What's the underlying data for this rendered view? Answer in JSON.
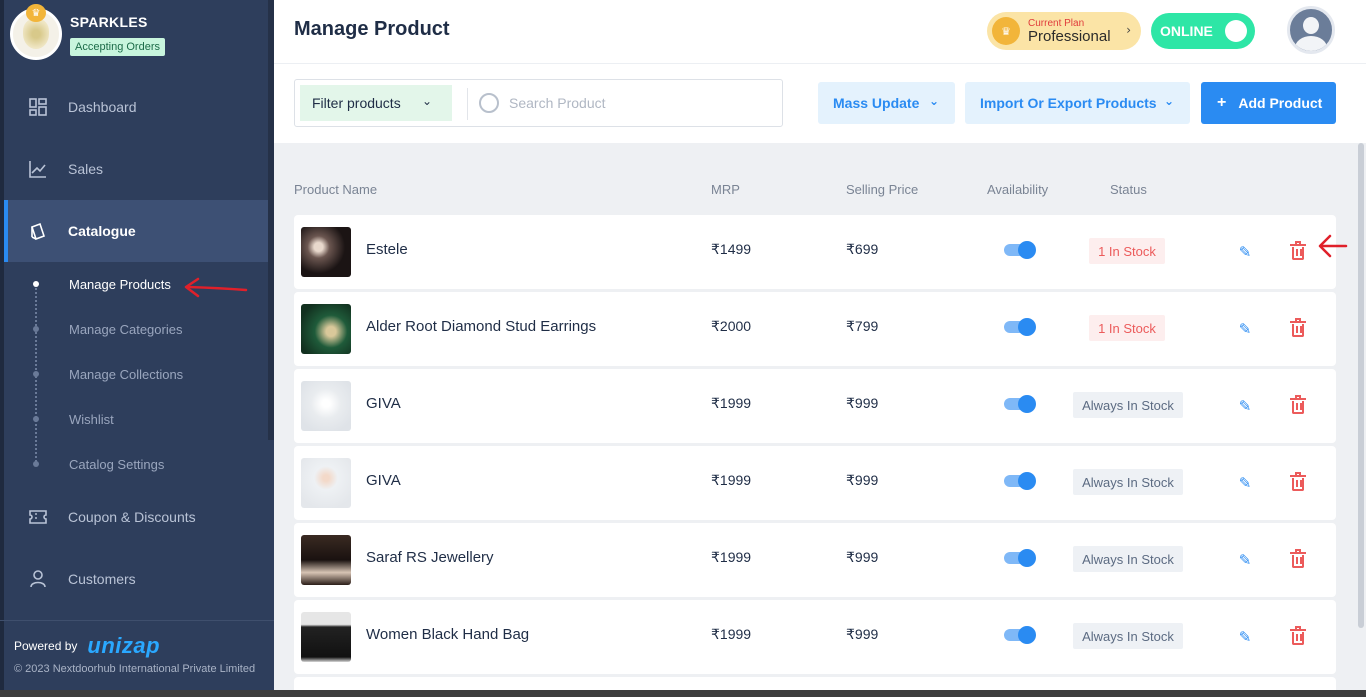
{
  "sidebar": {
    "shop_name": "SPARKLES",
    "shop_status": "Accepting Orders",
    "nav": [
      {
        "label": "Dashboard",
        "icon": "dashboard-icon"
      },
      {
        "label": "Sales",
        "icon": "chart-line-icon"
      },
      {
        "label": "Catalogue",
        "icon": "catalogue-icon",
        "active": true
      },
      {
        "label": "Coupon & Discounts",
        "icon": "coupon-icon"
      },
      {
        "label": "Customers",
        "icon": "user-icon"
      }
    ],
    "subnav": [
      {
        "label": "Manage Products",
        "active": true
      },
      {
        "label": "Manage Categories"
      },
      {
        "label": "Manage Collections"
      },
      {
        "label": "Wishlist"
      },
      {
        "label": "Catalog Settings"
      }
    ],
    "powered_by": "Powered by",
    "powered_brand": "unizap",
    "copyright": "© 2023 Nextdoorhub International Private Limited"
  },
  "header": {
    "title": "Manage Product",
    "plan_label": "Current Plan",
    "plan_name": "Professional",
    "online_label": "ONLINE"
  },
  "toolbar": {
    "filter_label": "Filter products",
    "search_placeholder": "Search Product",
    "mass_update": "Mass Update",
    "import_export": "Import Or Export Products",
    "add_product": "Add Product",
    "add_icon": "+"
  },
  "table": {
    "columns": [
      "Product Name",
      "MRP",
      "Selling Price",
      "Availability",
      "Status"
    ],
    "rows": [
      {
        "name": "Estele",
        "mrp": "₹1499",
        "price": "₹699",
        "available": true,
        "status": "1 In Stock",
        "status_type": "low"
      },
      {
        "name": "Alder Root Diamond Stud Earrings",
        "mrp": "₹2000",
        "price": "₹799",
        "available": true,
        "status": "1 In Stock",
        "status_type": "low"
      },
      {
        "name": "GIVA",
        "mrp": "₹1999",
        "price": "₹999",
        "available": true,
        "status": "Always In Stock",
        "status_type": "always"
      },
      {
        "name": "GIVA",
        "mrp": "₹1999",
        "price": "₹999",
        "available": true,
        "status": "Always In Stock",
        "status_type": "always"
      },
      {
        "name": "Saraf RS Jewellery",
        "mrp": "₹1999",
        "price": "₹999",
        "available": true,
        "status": "Always In Stock",
        "status_type": "always"
      },
      {
        "name": "Women Black Hand Bag",
        "mrp": "₹1999",
        "price": "₹999",
        "available": true,
        "status": "Always In Stock",
        "status_type": "always"
      }
    ]
  },
  "colors": {
    "sidebar_bg": "#2e3e5c",
    "accent": "#2a8bf2",
    "online": "#2ee6a6",
    "danger": "#ec5b5b"
  }
}
